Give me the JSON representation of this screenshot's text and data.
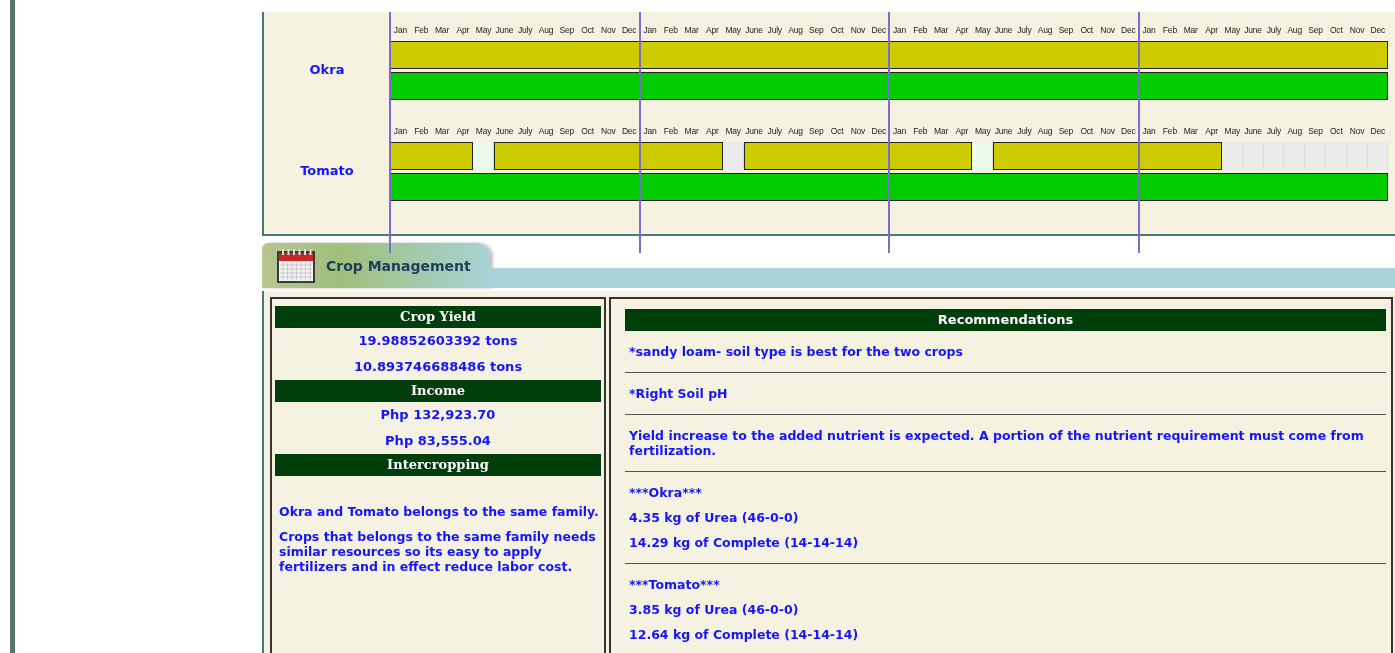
{
  "timeline": {
    "crops": [
      {
        "name": "Okra",
        "months": [
          "Jan",
          "Feb",
          "Mar",
          "Apr",
          "May",
          "June",
          "July",
          "Aug",
          "Sep",
          "Oct",
          "Nov",
          "Dec",
          "Jan",
          "Feb",
          "Mar",
          "Apr",
          "May",
          "June",
          "July",
          "Aug",
          "Sep",
          "Oct",
          "Nov",
          "Dec",
          "Jan",
          "Feb",
          "Mar",
          "Apr",
          "May",
          "June",
          "July",
          "Aug",
          "Sep",
          "Oct",
          "Nov",
          "Dec",
          "Jan",
          "Feb",
          "Mar",
          "Apr",
          "May",
          "June",
          "July",
          "Aug",
          "Sep",
          "Oct",
          "Nov",
          "Dec"
        ],
        "bars": [
          {
            "color": "#cccc00",
            "cells": [
              {
                "kind": "filled"
              },
              {
                "kind": "filled"
              },
              {
                "kind": "filled"
              },
              {
                "kind": "filled"
              },
              {
                "kind": "filled"
              },
              {
                "kind": "filled"
              },
              {
                "kind": "filled"
              },
              {
                "kind": "filled"
              },
              {
                "kind": "filled"
              },
              {
                "kind": "filled"
              },
              {
                "kind": "filled"
              },
              {
                "kind": "filled"
              },
              {
                "kind": "filled"
              },
              {
                "kind": "filled"
              },
              {
                "kind": "filled"
              },
              {
                "kind": "filled"
              },
              {
                "kind": "filled"
              },
              {
                "kind": "filled"
              },
              {
                "kind": "filled"
              },
              {
                "kind": "filled"
              },
              {
                "kind": "filled"
              },
              {
                "kind": "filled"
              },
              {
                "kind": "filled"
              },
              {
                "kind": "filled"
              },
              {
                "kind": "filled"
              },
              {
                "kind": "filled"
              },
              {
                "kind": "filled"
              },
              {
                "kind": "filled"
              },
              {
                "kind": "filled"
              },
              {
                "kind": "filled"
              },
              {
                "kind": "filled"
              },
              {
                "kind": "filled"
              },
              {
                "kind": "filled"
              },
              {
                "kind": "filled"
              },
              {
                "kind": "filled"
              },
              {
                "kind": "filled"
              },
              {
                "kind": "filled"
              },
              {
                "kind": "filled"
              },
              {
                "kind": "filled"
              },
              {
                "kind": "filled"
              },
              {
                "kind": "filled"
              },
              {
                "kind": "filled"
              },
              {
                "kind": "filled"
              },
              {
                "kind": "filled"
              },
              {
                "kind": "filled"
              },
              {
                "kind": "filled"
              },
              {
                "kind": "filled"
              },
              {
                "kind": "filled"
              }
            ]
          },
          {
            "color": "#00cc00",
            "cells": [
              {
                "kind": "filled"
              },
              {
                "kind": "filled"
              },
              {
                "kind": "filled"
              },
              {
                "kind": "filled"
              },
              {
                "kind": "filled"
              },
              {
                "kind": "filled"
              },
              {
                "kind": "filled"
              },
              {
                "kind": "filled"
              },
              {
                "kind": "filled"
              },
              {
                "kind": "filled"
              },
              {
                "kind": "filled"
              },
              {
                "kind": "filled"
              },
              {
                "kind": "filled"
              },
              {
                "kind": "filled"
              },
              {
                "kind": "filled"
              },
              {
                "kind": "filled"
              },
              {
                "kind": "filled"
              },
              {
                "kind": "filled"
              },
              {
                "kind": "filled"
              },
              {
                "kind": "filled"
              },
              {
                "kind": "filled"
              },
              {
                "kind": "filled"
              },
              {
                "kind": "filled"
              },
              {
                "kind": "filled"
              },
              {
                "kind": "filled"
              },
              {
                "kind": "filled"
              },
              {
                "kind": "filled"
              },
              {
                "kind": "filled"
              },
              {
                "kind": "filled"
              },
              {
                "kind": "filled"
              },
              {
                "kind": "filled"
              },
              {
                "kind": "filled"
              },
              {
                "kind": "filled"
              },
              {
                "kind": "filled"
              },
              {
                "kind": "filled"
              },
              {
                "kind": "filled"
              },
              {
                "kind": "filled"
              },
              {
                "kind": "filled"
              },
              {
                "kind": "filled"
              },
              {
                "kind": "filled"
              },
              {
                "kind": "filled"
              },
              {
                "kind": "filled"
              },
              {
                "kind": "filled"
              },
              {
                "kind": "filled"
              },
              {
                "kind": "filled"
              },
              {
                "kind": "filled"
              },
              {
                "kind": "filled"
              },
              {
                "kind": "filled"
              }
            ]
          }
        ]
      },
      {
        "name": "Tomato",
        "months": [
          "Jan",
          "Feb",
          "Mar",
          "Apr",
          "May",
          "June",
          "July",
          "Aug",
          "Sep",
          "Oct",
          "Nov",
          "Dec",
          "Jan",
          "Feb",
          "Mar",
          "Apr",
          "May",
          "June",
          "July",
          "Aug",
          "Sep",
          "Oct",
          "Nov",
          "Dec",
          "Jan",
          "Feb",
          "Mar",
          "Apr",
          "May",
          "June",
          "July",
          "Aug",
          "Sep",
          "Oct",
          "Nov",
          "Dec",
          "Jan",
          "Feb",
          "Mar",
          "Apr",
          "May",
          "June",
          "July",
          "Aug",
          "Sep",
          "Oct",
          "Nov",
          "Dec"
        ],
        "bars": [
          {
            "color": "#cccc00",
            "cells": [
              {
                "kind": "filled"
              },
              {
                "kind": "filled"
              },
              {
                "kind": "filled"
              },
              {
                "kind": "filled"
              },
              {
                "kind": "fallow"
              },
              {
                "kind": "filled"
              },
              {
                "kind": "filled"
              },
              {
                "kind": "filled"
              },
              {
                "kind": "filled"
              },
              {
                "kind": "filled"
              },
              {
                "kind": "filled"
              },
              {
                "kind": "filled"
              },
              {
                "kind": "filled"
              },
              {
                "kind": "filled"
              },
              {
                "kind": "filled"
              },
              {
                "kind": "filled"
              },
              {
                "kind": "empty"
              },
              {
                "kind": "filled"
              },
              {
                "kind": "filled"
              },
              {
                "kind": "filled"
              },
              {
                "kind": "filled"
              },
              {
                "kind": "filled"
              },
              {
                "kind": "filled"
              },
              {
                "kind": "filled"
              },
              {
                "kind": "filled"
              },
              {
                "kind": "filled"
              },
              {
                "kind": "filled"
              },
              {
                "kind": "filled"
              },
              {
                "kind": "fallow"
              },
              {
                "kind": "filled"
              },
              {
                "kind": "filled"
              },
              {
                "kind": "filled"
              },
              {
                "kind": "filled"
              },
              {
                "kind": "filled"
              },
              {
                "kind": "filled"
              },
              {
                "kind": "filled"
              },
              {
                "kind": "filled"
              },
              {
                "kind": "filled"
              },
              {
                "kind": "filled"
              },
              {
                "kind": "filled"
              },
              {
                "kind": "empty"
              },
              {
                "kind": "empty"
              },
              {
                "kind": "empty"
              },
              {
                "kind": "empty"
              },
              {
                "kind": "empty"
              },
              {
                "kind": "empty"
              },
              {
                "kind": "empty"
              },
              {
                "kind": "empty"
              }
            ]
          },
          {
            "color": "#00cc00",
            "cells": [
              {
                "kind": "filled"
              },
              {
                "kind": "filled"
              },
              {
                "kind": "filled"
              },
              {
                "kind": "filled"
              },
              {
                "kind": "filled"
              },
              {
                "kind": "filled"
              },
              {
                "kind": "filled"
              },
              {
                "kind": "filled"
              },
              {
                "kind": "filled"
              },
              {
                "kind": "filled"
              },
              {
                "kind": "filled"
              },
              {
                "kind": "filled"
              },
              {
                "kind": "filled"
              },
              {
                "kind": "filled"
              },
              {
                "kind": "filled"
              },
              {
                "kind": "filled"
              },
              {
                "kind": "filled"
              },
              {
                "kind": "filled"
              },
              {
                "kind": "filled"
              },
              {
                "kind": "filled"
              },
              {
                "kind": "filled"
              },
              {
                "kind": "filled"
              },
              {
                "kind": "filled"
              },
              {
                "kind": "filled"
              },
              {
                "kind": "filled"
              },
              {
                "kind": "filled"
              },
              {
                "kind": "filled"
              },
              {
                "kind": "filled"
              },
              {
                "kind": "filled"
              },
              {
                "kind": "filled"
              },
              {
                "kind": "filled"
              },
              {
                "kind": "filled"
              },
              {
                "kind": "filled"
              },
              {
                "kind": "filled"
              },
              {
                "kind": "filled"
              },
              {
                "kind": "filled"
              },
              {
                "kind": "filled"
              },
              {
                "kind": "filled"
              },
              {
                "kind": "filled"
              },
              {
                "kind": "filled"
              },
              {
                "kind": "filled"
              },
              {
                "kind": "filled"
              },
              {
                "kind": "filled"
              },
              {
                "kind": "filled"
              },
              {
                "kind": "filled"
              },
              {
                "kind": "filled"
              },
              {
                "kind": "filled"
              },
              {
                "kind": "filled"
              }
            ]
          }
        ]
      }
    ]
  },
  "section_tab": {
    "title": "Crop Management"
  },
  "summary": {
    "sections": [
      {
        "heading": "Crop Yield",
        "values": [
          "19.98852603392 tons",
          "10.893746688486 tons"
        ]
      },
      {
        "heading": "Income",
        "values": [
          "Php 132,923.70",
          "Php 83,555.04"
        ]
      },
      {
        "heading": "Intercropping",
        "paragraphs": [
          "Okra and Tomato belongs to the same family.",
          "Crops that belongs to the same family needs similar resources so its easy to apply fertilizers and in effect reduce labor cost."
        ]
      }
    ]
  },
  "recommendations": {
    "heading": "Recommendations",
    "groups": [
      {
        "lines": [
          "*sandy loam- soil type is best for the two crops"
        ]
      },
      {
        "lines": [
          "*Right Soil pH"
        ]
      },
      {
        "lines": [
          "Yield increase to the added nutrient is expected. A portion of the nutrient requirement must come from fertilization."
        ]
      },
      {
        "lines": [
          "***Okra***",
          "4.35 kg of Urea (46-0-0)",
          "14.29 kg of Complete (14-14-14)"
        ]
      },
      {
        "lines": [
          "***Tomato***",
          "3.85 kg of Urea (46-0-0)",
          "12.64 kg of Complete (14-14-14)"
        ]
      }
    ]
  }
}
